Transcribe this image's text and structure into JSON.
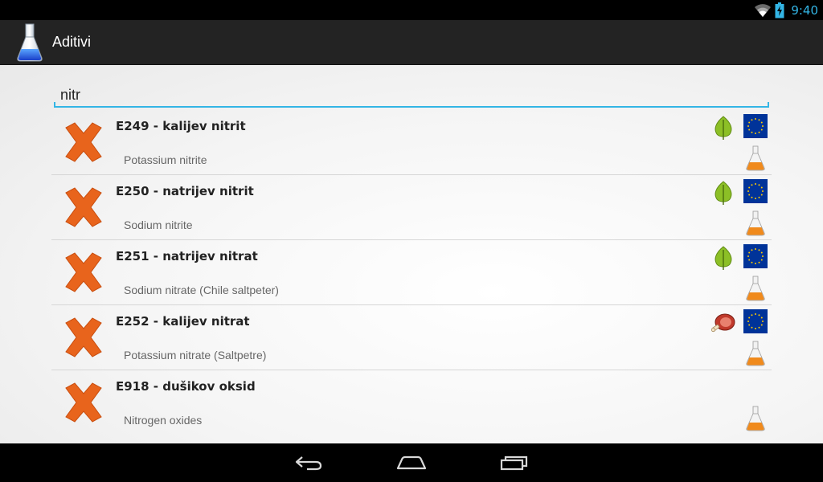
{
  "status": {
    "time": "9:40",
    "icons": [
      "wifi-icon",
      "battery-charging-icon"
    ]
  },
  "app": {
    "title": "Aditivi",
    "icon": "flask-icon"
  },
  "search": {
    "value": "nitr"
  },
  "colors": {
    "accent": "#33b5e5",
    "danger": "#e8641c",
    "leaf": "#8cbf26",
    "eu": "#003399",
    "eu_star": "#ffcc00"
  },
  "items": [
    {
      "code": "E249 - kalijev nitrit",
      "english": "Potassium nitrite",
      "status_icon": "x-icon",
      "source_icon": "leaf-icon",
      "approval_icon": "eu-flag-icon",
      "category_icon": "flask-icon"
    },
    {
      "code": "E250 - natrijev nitrit",
      "english": "Sodium nitrite",
      "status_icon": "x-icon",
      "source_icon": "leaf-icon",
      "approval_icon": "eu-flag-icon",
      "category_icon": "flask-icon"
    },
    {
      "code": "E251 - natrijev nitrat",
      "english": "Sodium nitrate (Chile saltpeter)",
      "status_icon": "x-icon",
      "source_icon": "leaf-icon",
      "approval_icon": "eu-flag-icon",
      "category_icon": "flask-icon"
    },
    {
      "code": "E252 - kalijev nitrat",
      "english": "Potassium nitrate (Saltpetre)",
      "status_icon": "x-icon",
      "source_icon": "meat-icon",
      "approval_icon": "eu-flag-icon",
      "category_icon": "flask-icon"
    },
    {
      "code": "E918 - dušikov oksid",
      "english": "Nitrogen oxides",
      "status_icon": "x-icon",
      "source_icon": "",
      "approval_icon": "",
      "category_icon": "flask-icon"
    }
  ],
  "nav": {
    "buttons": [
      "back-icon",
      "home-icon",
      "recents-icon"
    ]
  }
}
